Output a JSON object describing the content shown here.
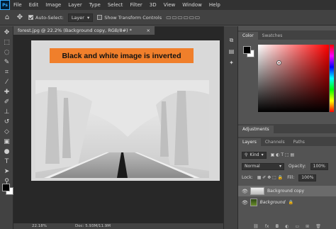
{
  "menubar": {
    "logo": "Ps",
    "items": [
      "File",
      "Edit",
      "Image",
      "Layer",
      "Type",
      "Select",
      "Filter",
      "3D",
      "View",
      "Window",
      "Help"
    ]
  },
  "options": {
    "auto_select_label": "Auto-Select:",
    "auto_select_value": "Layer",
    "show_transform_label": "Show Transform Controls"
  },
  "document": {
    "tab_title": "forest.jpg @ 22.2% (Background copy, RGB/8#) *",
    "close": "×",
    "caption": "Black and white image is inverted",
    "status_zoom": "22.18%",
    "status_doc": "Doc: 5.93M/11.9M"
  },
  "color_panel": {
    "tabs": [
      "Color",
      "Swatches"
    ],
    "accent_hue": "#ff0000"
  },
  "adjustments_panel": {
    "tabs": [
      "Adjustments"
    ]
  },
  "layers_panel": {
    "tabs": [
      "Layers",
      "Channels",
      "Paths"
    ],
    "filter_kind": "Kind",
    "blend_mode": "Normal",
    "opacity_label": "Opacity:",
    "opacity_value": "100%",
    "lock_label": "Lock:",
    "fill_label": "Fill:",
    "fill_value": "100%",
    "layers": [
      {
        "name": "Background copy",
        "selected": true
      },
      {
        "name": "Background",
        "selected": false
      }
    ],
    "footer_icons": [
      "link-icon",
      "fx-icon",
      "mask-icon",
      "adjustment-icon",
      "group-icon",
      "new-layer-icon",
      "trash-icon"
    ]
  }
}
